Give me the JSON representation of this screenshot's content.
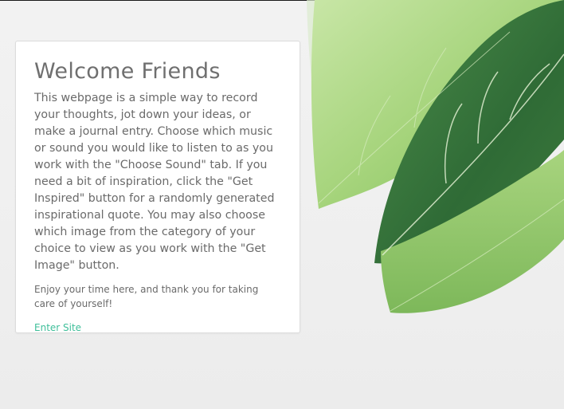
{
  "card": {
    "title": "Welcome Friends",
    "intro": "This webpage is a simple way to record your thoughts, jot down your ideas, or make a journal entry. Choose which music or sound you would like to listen to as you work with the \"Choose Sound\" tab. If you need a bit of inspiration, click the \"Get Inspired\" button for a randomly generated inspirational quote. You may also choose which image from the category of your choice to view as you work with the \"Get Image\" button.",
    "thanks": "Enjoy your time here, and thank you for taking care of yourself!",
    "enter_link": "Enter Site"
  },
  "colors": {
    "link": "#3fbf9a",
    "text": "#6a6a6a",
    "leaf_dark": "#2f6a3a",
    "leaf_light": "#9fce72"
  }
}
